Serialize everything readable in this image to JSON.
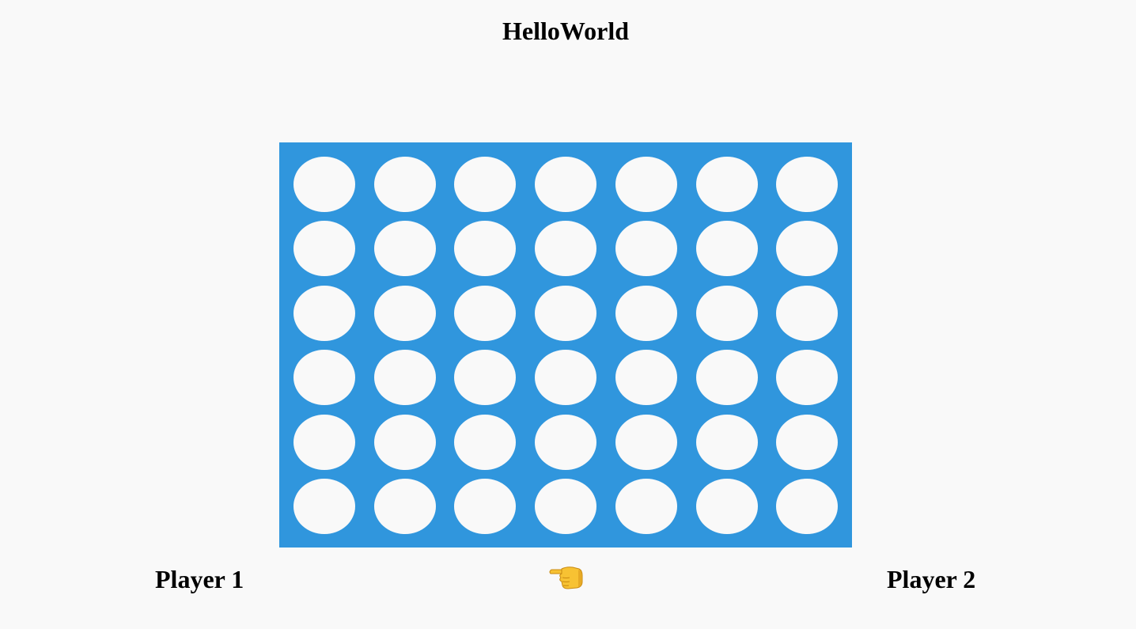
{
  "header": {
    "title": "HelloWorld"
  },
  "board": {
    "rows": 6,
    "columns": 7,
    "board_color": "#3096dd",
    "empty_color": "#f9f9f9",
    "cells": [
      [
        "empty",
        "empty",
        "empty",
        "empty",
        "empty",
        "empty",
        "empty"
      ],
      [
        "empty",
        "empty",
        "empty",
        "empty",
        "empty",
        "empty",
        "empty"
      ],
      [
        "empty",
        "empty",
        "empty",
        "empty",
        "empty",
        "empty",
        "empty"
      ],
      [
        "empty",
        "empty",
        "empty",
        "empty",
        "empty",
        "empty",
        "empty"
      ],
      [
        "empty",
        "empty",
        "empty",
        "empty",
        "empty",
        "empty",
        "empty"
      ],
      [
        "empty",
        "empty",
        "empty",
        "empty",
        "empty",
        "empty",
        "empty"
      ]
    ]
  },
  "players": {
    "player1_label": "Player 1",
    "player2_label": "Player 2"
  },
  "turn": {
    "current": "player1",
    "icon": "hand-pointing-left-icon"
  }
}
